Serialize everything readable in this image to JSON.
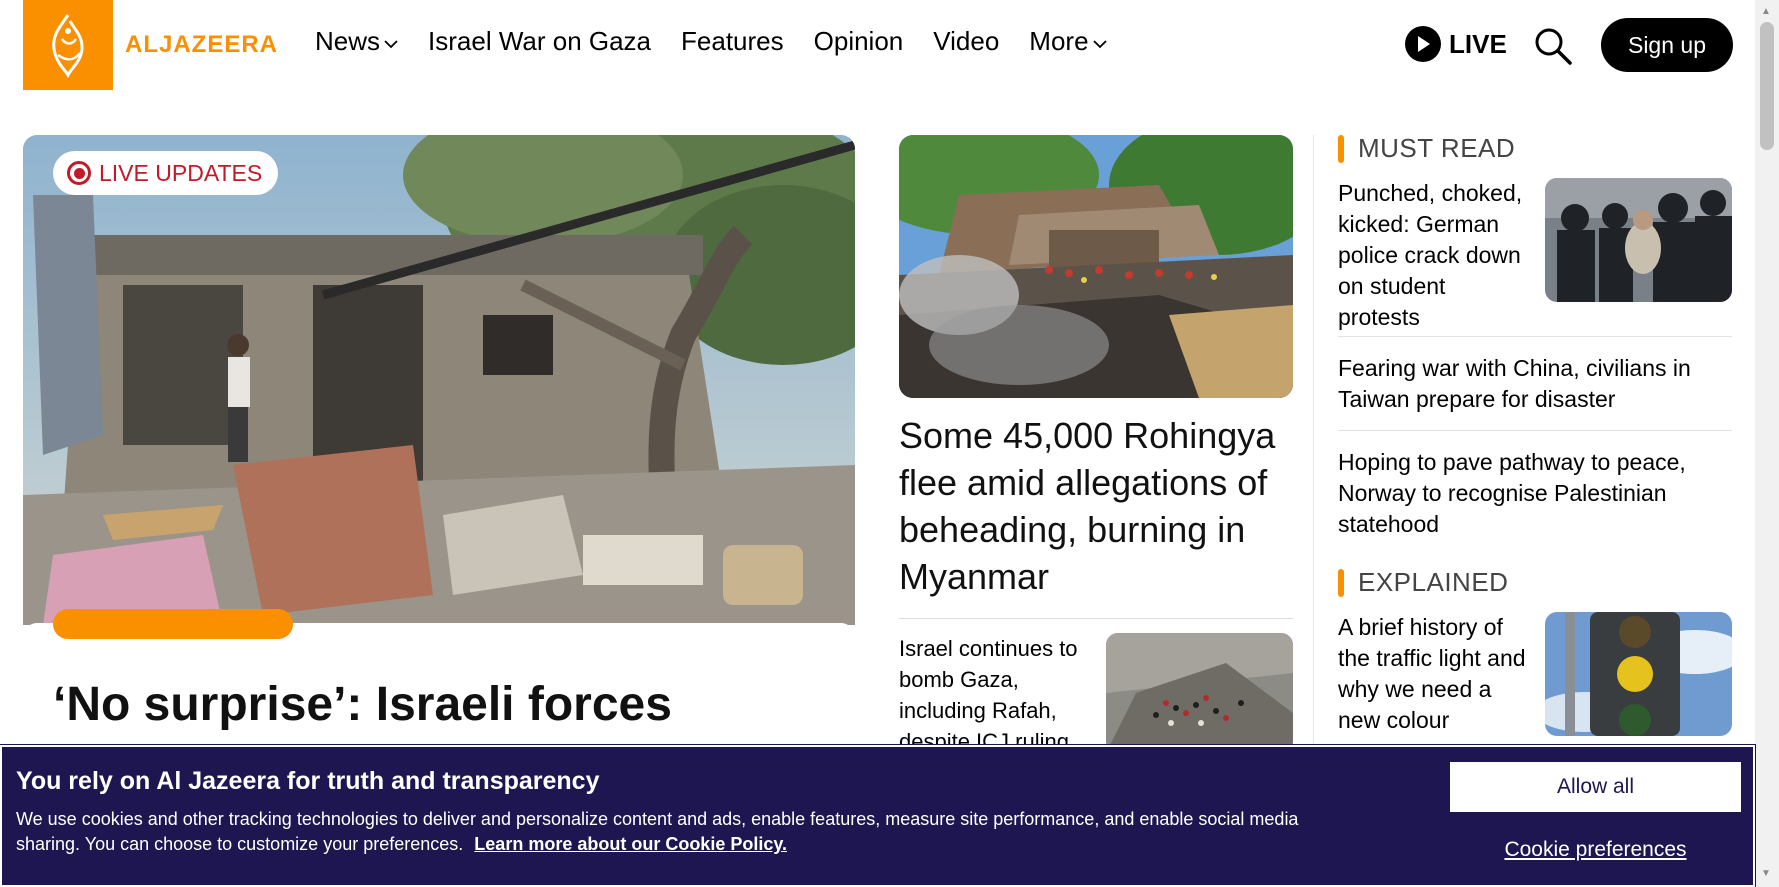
{
  "header": {
    "logo_text": "ALJAZEERA",
    "nav": [
      {
        "label": "News",
        "has_dropdown": true
      },
      {
        "label": "Israel War on Gaza",
        "has_dropdown": false
      },
      {
        "label": "Features",
        "has_dropdown": false
      },
      {
        "label": "Opinion",
        "has_dropdown": false
      },
      {
        "label": "Video",
        "has_dropdown": false
      },
      {
        "label": "More",
        "has_dropdown": true
      }
    ],
    "live_label": "LIVE",
    "signup_label": "Sign up"
  },
  "hero": {
    "badge": "LIVE UPDATES",
    "title": "‘No surprise’: Israeli forces"
  },
  "middle": {
    "lead_title": "Some 45,000 Rohingya flee amid allegations of beheading, burning in Myanmar",
    "story": "Israel continues to bomb Gaza, including Rafah, despite ICJ ruling"
  },
  "right": {
    "must_read_label": "MUST READ",
    "must_read": [
      {
        "title": "Punched, choked, kicked: German police crack down on student protests"
      },
      {
        "title": "Fearing war with China, civilians in Taiwan prepare for disaster"
      },
      {
        "title": "Hoping to pave pathway to peace, Norway to recognise Palestinian statehood"
      }
    ],
    "explained_label": "EXPLAINED",
    "explained": [
      {
        "title": "A brief history of the traffic light and why we need a new colour"
      }
    ]
  },
  "cookie": {
    "title": "You rely on Al Jazeera for truth and transparency",
    "body": "We use cookies and other tracking technologies to deliver and personalize content and ads, enable features, measure site performance, and enable social media sharing. You can choose to customize your preferences.",
    "link": "Learn more about our Cookie Policy.",
    "allow_label": "Allow all",
    "preferences_label": "Cookie preferences"
  },
  "colors": {
    "brand_orange": "#fa9000",
    "live_red": "#c21a28",
    "cookie_bg": "#1d1650"
  }
}
